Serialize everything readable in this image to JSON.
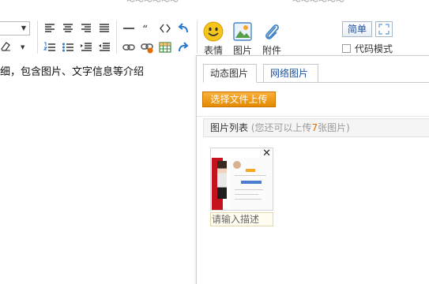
{
  "top_strip": {
    "left_fragment": "～～～～～～",
    "right_fragment": "～～～～～～"
  },
  "toolbar": {
    "font_select_value": "",
    "emoji_label": "表情",
    "image_label": "图片",
    "attachment_label": "附件",
    "simple_label": "简单",
    "code_mode_label": "代码模式",
    "icons": [
      "align-left-icon",
      "align-center-icon",
      "align-right-icon",
      "align-justify-icon",
      "horizontal-rule-icon",
      "quote-icon",
      "code-icon",
      "undo-icon",
      "ordered-list-icon",
      "unordered-list-icon",
      "indent-icon",
      "outdent-icon",
      "link-icon",
      "unlink-icon",
      "table-icon",
      "redo-icon",
      "eraser-icon",
      "fullscreen-icon"
    ]
  },
  "editor": {
    "content_text": "细，包含图片、文字信息等介绍"
  },
  "dialog": {
    "tabs": [
      {
        "label": "动态图片",
        "active": true
      },
      {
        "label": "网络图片",
        "active": false
      }
    ],
    "upload_button": "选择文件上传",
    "list_title": "图片列表",
    "list_hint_prefix": "(您还可以上传",
    "list_hint_count": "7",
    "list_hint_suffix": "张图片)",
    "thumbnail": {
      "close_symbol": "✕",
      "description_placeholder": "请输入描述"
    }
  },
  "colors": {
    "upload_button": "#f09a10",
    "link_blue": "#1e50a2",
    "count_orange": "#e46b00"
  }
}
